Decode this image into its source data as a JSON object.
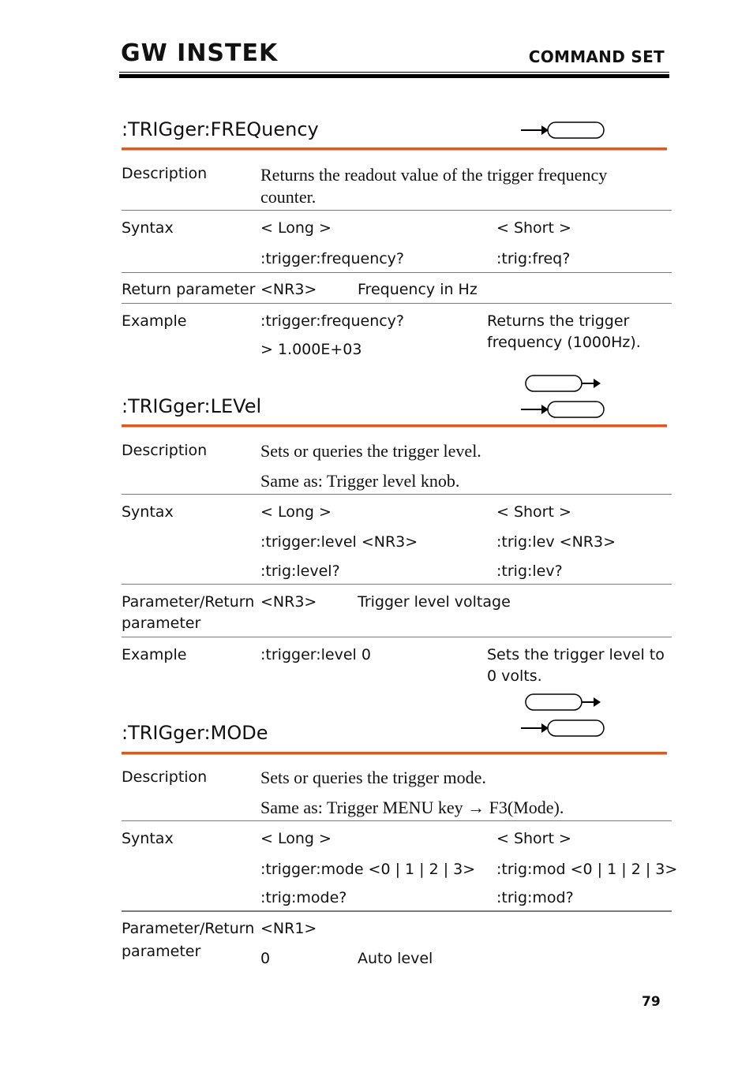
{
  "header": {
    "logo": "GW INSTEK",
    "section": "COMMAND SET"
  },
  "sections": [
    {
      "title": ":TRIGger:FREQuency",
      "icons": [
        "query-icon"
      ],
      "description": [
        "Returns the readout value of the trigger frequency",
        "counter."
      ],
      "syntax": {
        "label": "Syntax",
        "long_header": "< Long >",
        "short_header": "< Short >",
        "rows": [
          {
            "long": ":trigger:frequency?",
            "short": ":trig:freq?"
          }
        ]
      },
      "param": {
        "label": "Return parameter",
        "type": "<NR3>",
        "meaning": "Frequency in Hz"
      },
      "example": {
        "label": "Example",
        "lines": [
          ":trigger:frequency?",
          "> 1.000E+03"
        ],
        "note": [
          "Returns the trigger",
          "frequency (1000Hz)."
        ]
      }
    },
    {
      "title": ":TRIGger:LEVel",
      "icons": [
        "set-icon",
        "query-icon"
      ],
      "description": [
        "Sets or queries the trigger level.",
        "Same as: Trigger level knob."
      ],
      "syntax": {
        "label": "Syntax",
        "long_header": "< Long >",
        "short_header": "< Short >",
        "rows": [
          {
            "long": ":trigger:level <NR3>",
            "short": ":trig:lev <NR3>"
          },
          {
            "long": ":trig:level?",
            "short": ":trig:lev?"
          }
        ]
      },
      "param": {
        "label": [
          "Parameter/Return",
          "parameter"
        ],
        "type": "<NR3>",
        "meaning": "Trigger level voltage"
      },
      "example": {
        "label": "Example",
        "lines": [
          ":trigger:level 0"
        ],
        "note": [
          "Sets the trigger level to",
          "0 volts."
        ]
      }
    },
    {
      "title": ":TRIGger:MODe",
      "icons": [
        "set-icon",
        "query-icon"
      ],
      "description": [
        "Sets or queries the trigger mode.",
        "Same as: Trigger MENU key → F3(Mode)."
      ],
      "syntax": {
        "label": "Syntax",
        "long_header": "< Long >",
        "short_header": "< Short >",
        "rows": [
          {
            "long": ":trigger:mode <0 | 1 | 2 | 3>",
            "short": ":trig:mod <0 | 1 | 2 | 3>"
          },
          {
            "long": ":trig:mode?",
            "short": ":trig:mod?"
          }
        ]
      },
      "param": {
        "label": [
          "Parameter/Return",
          "parameter"
        ],
        "type": "<NR1>",
        "values": [
          {
            "value": "0",
            "meaning": "Auto level"
          }
        ]
      }
    }
  ],
  "description_label": "Description",
  "page_number": "79"
}
